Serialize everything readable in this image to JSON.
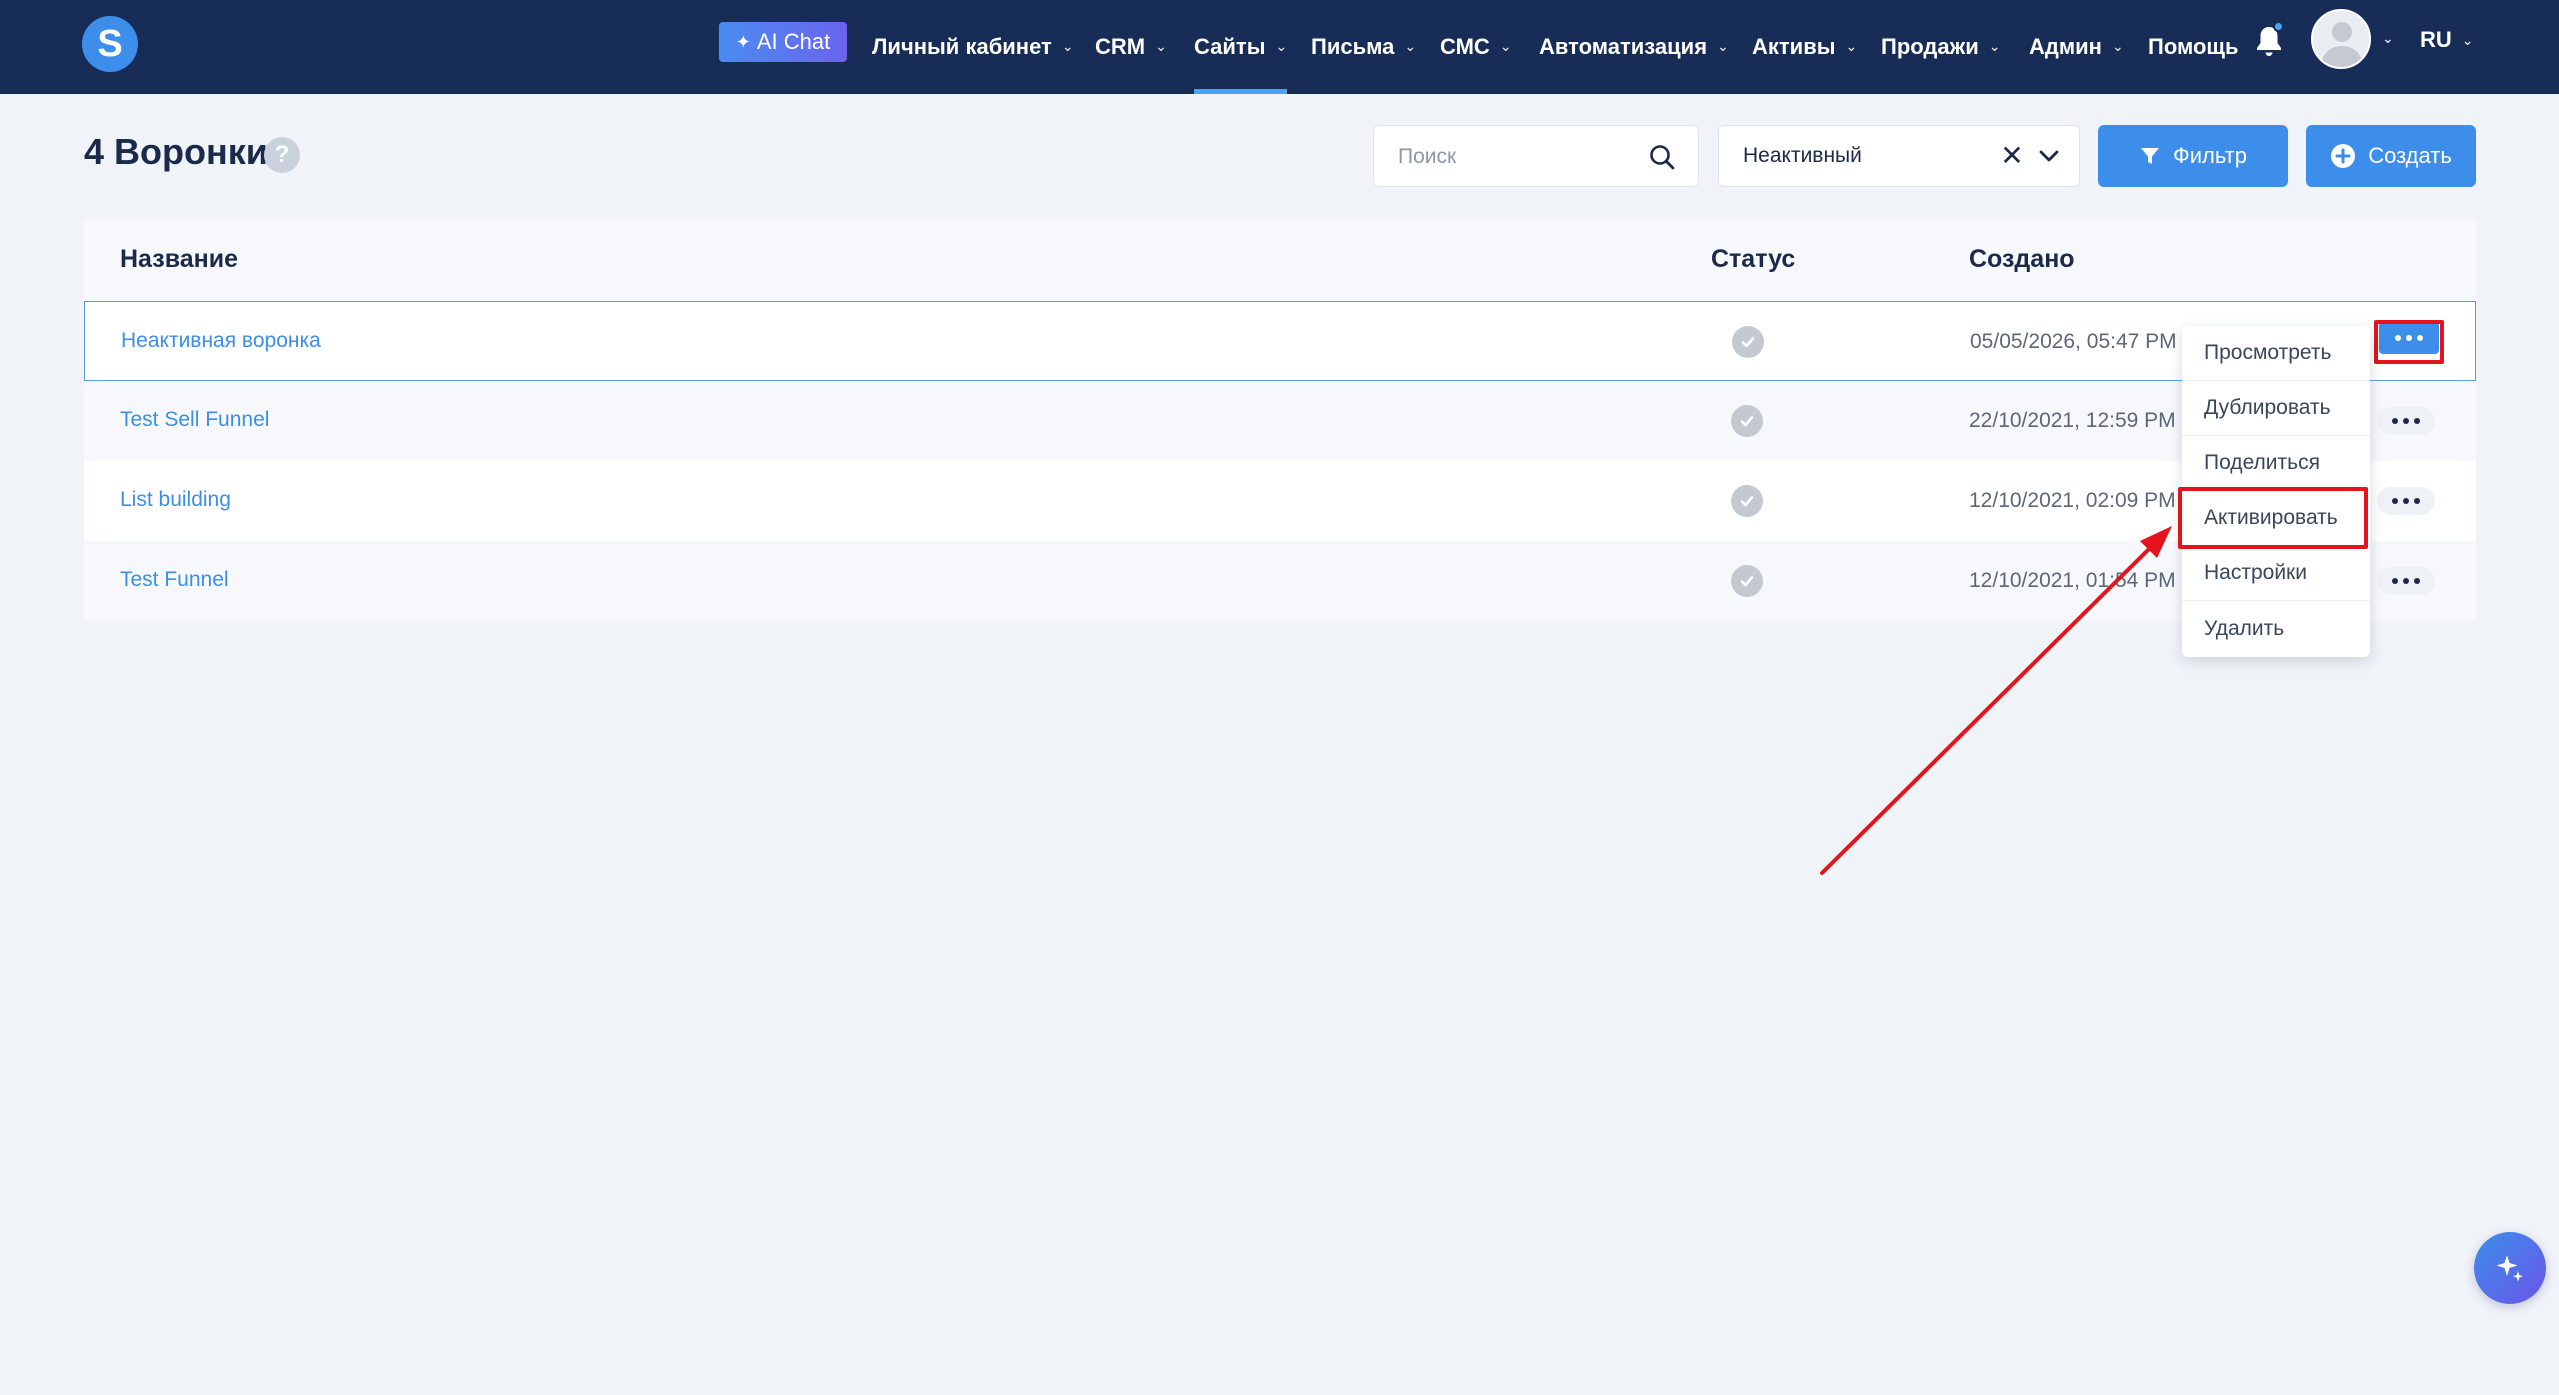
{
  "app": {
    "logo_letter": "S",
    "ai_chat_label": "AI Chat"
  },
  "nav": {
    "items": [
      {
        "label": "Личный кабинет"
      },
      {
        "label": "CRM"
      },
      {
        "label": "Сайты",
        "active": true
      },
      {
        "label": "Письма"
      },
      {
        "label": "СМС"
      },
      {
        "label": "Автоматизация"
      },
      {
        "label": "Активы"
      },
      {
        "label": "Продажи"
      },
      {
        "label": "Админ"
      },
      {
        "label": "Помощь"
      }
    ],
    "language": "RU",
    "bell_icon": "bell-icon",
    "avatar_icon": "user-avatar-icon"
  },
  "page": {
    "title": "4 Воронки",
    "help_icon": "question-mark-icon"
  },
  "toolbar": {
    "search_placeholder": "Поиск",
    "search_value": "",
    "status_filter_value": "Неактивный",
    "filter_label": "Фильтр",
    "create_label": "Создать"
  },
  "table": {
    "columns": [
      "Название",
      "Статус",
      "Создано"
    ],
    "rows": [
      {
        "name": "Неактивная воронка",
        "status": "inactive",
        "created": "05/05/2026, 05:47 PM"
      },
      {
        "name": "Test Sell Funnel",
        "status": "inactive",
        "created": "22/10/2021, 12:59 PM"
      },
      {
        "name": "List building",
        "status": "inactive",
        "created": "12/10/2021, 02:09 PM"
      },
      {
        "name": "Test Funnel",
        "status": "inactive",
        "created": "12/10/2021, 01:54 PM"
      }
    ]
  },
  "context_menu": {
    "items": [
      "Просмотреть",
      "Дублировать",
      "Поделиться",
      "Активировать",
      "Настройки",
      "Удалить"
    ],
    "highlighted_item": "Активировать"
  },
  "colors": {
    "nav_bg": "#182c58",
    "accent": "#3d8eea",
    "highlight": "#e3141b",
    "page_bg": "#f0f3f8"
  }
}
